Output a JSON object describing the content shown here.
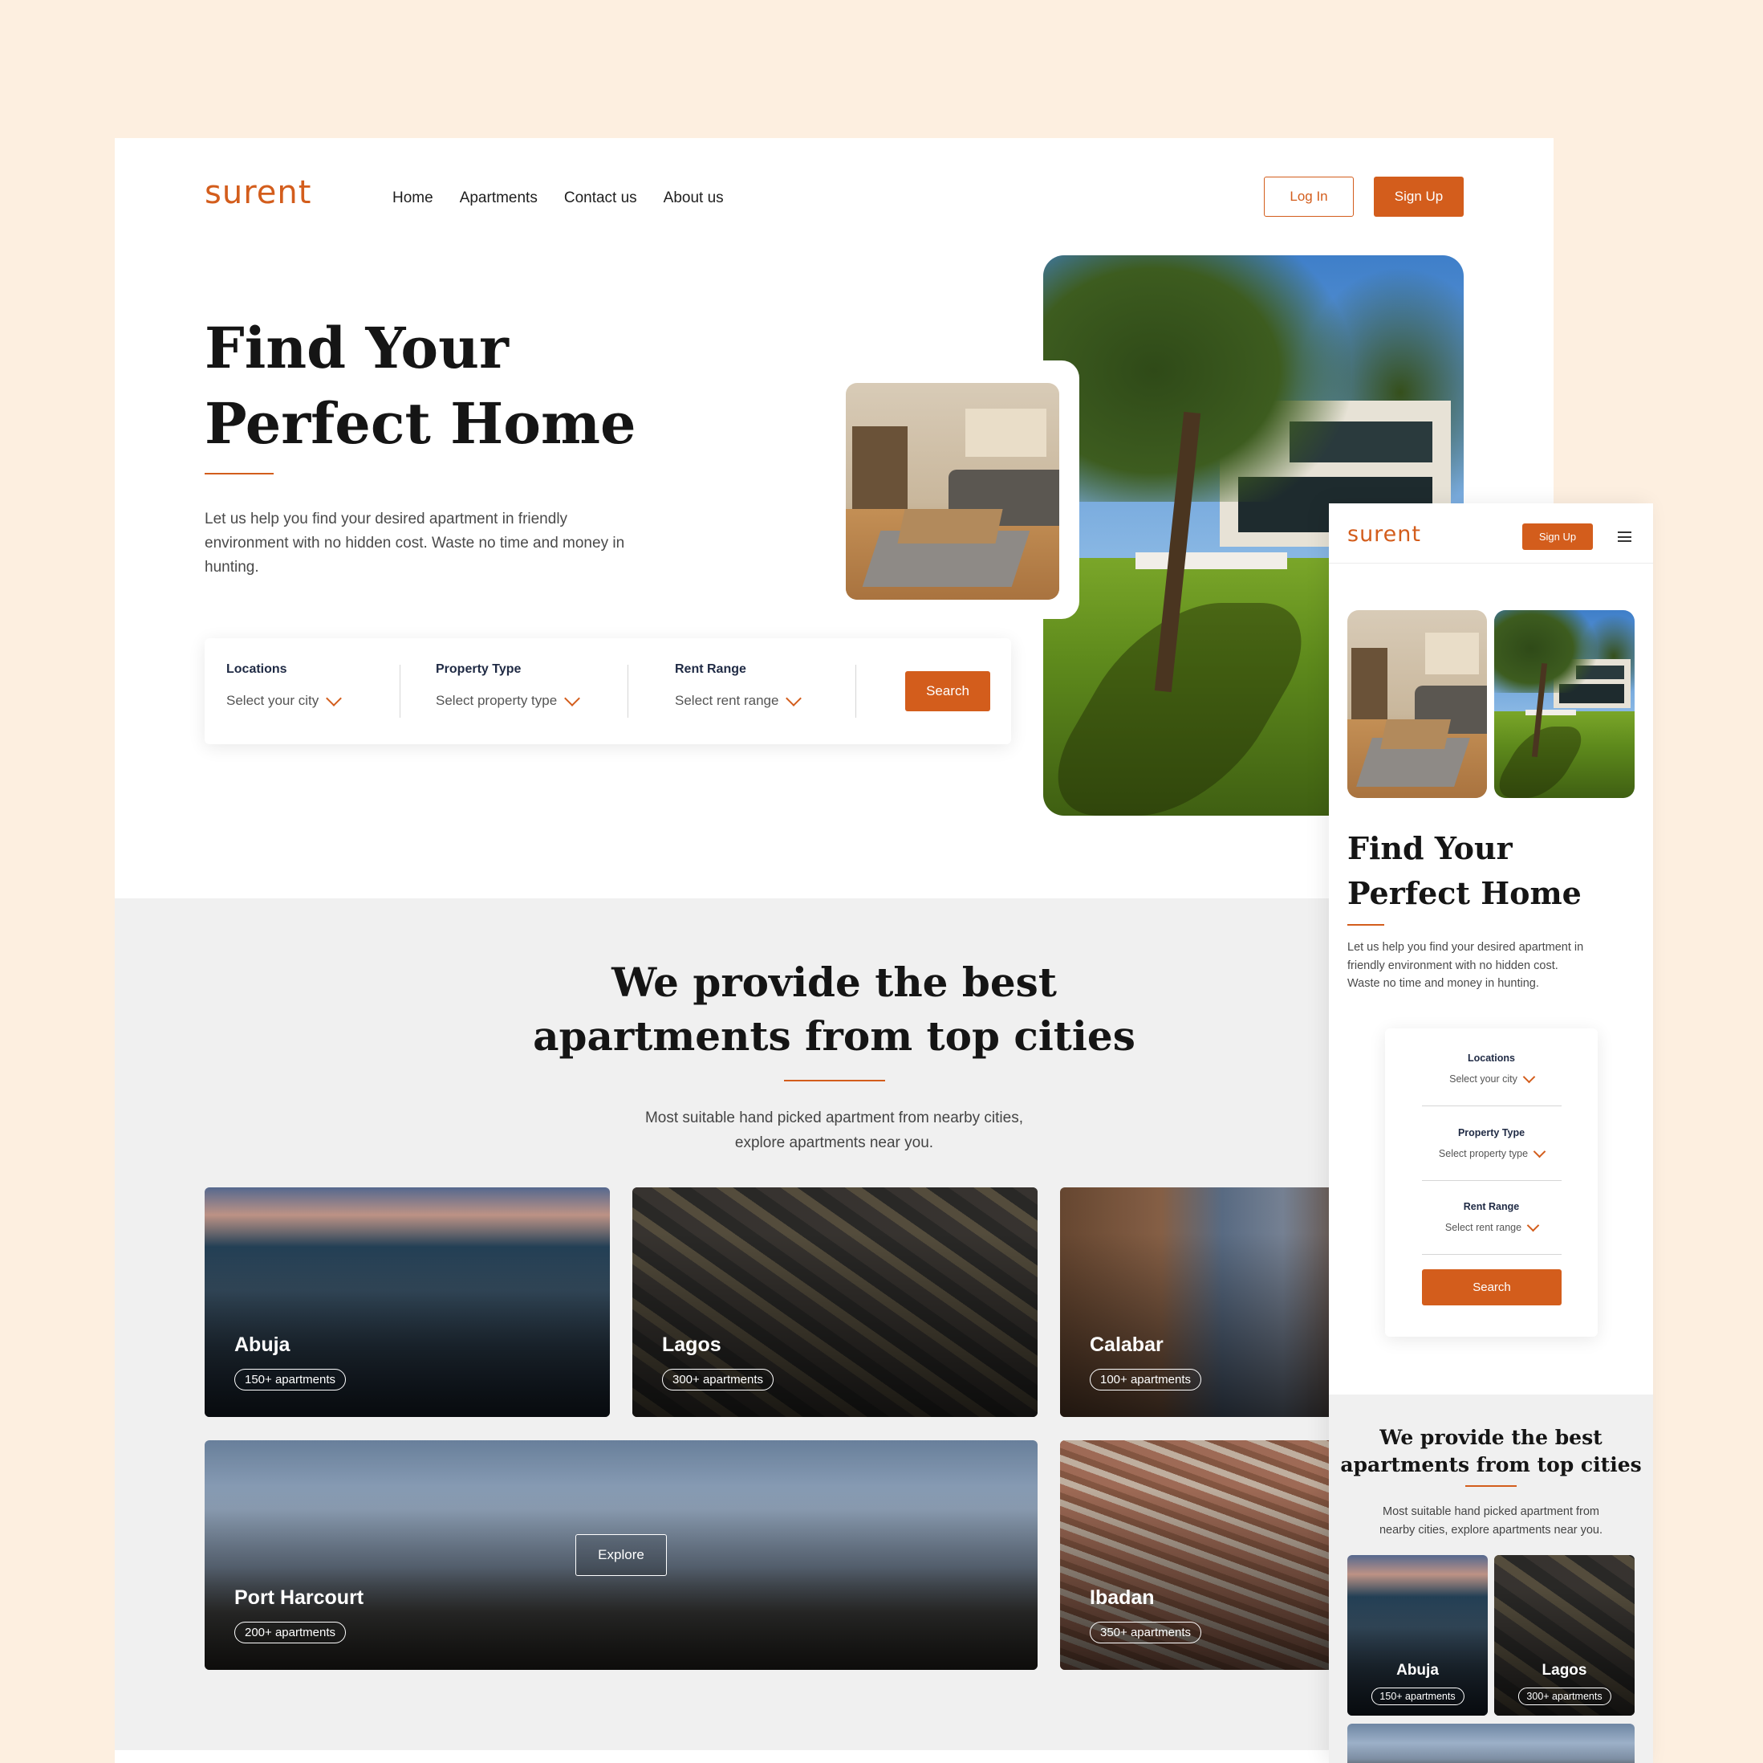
{
  "brand": {
    "logo": "surent",
    "accent": "#d35d1c",
    "page_background": "#fdefe0",
    "section_gray": "#f0f0f0"
  },
  "desktop": {
    "nav": [
      "Home",
      "Apartments",
      "Contact us",
      "About us"
    ],
    "login_label": "Log In",
    "signup_label": "Sign Up",
    "hero": {
      "title_line1": "Find Your",
      "title_line2": "Perfect Home",
      "description": "Let us help you find your desired apartment in friendly environment with no hidden cost. Waste no time and money in hunting."
    },
    "search": {
      "locations_label": "Locations",
      "locations_value": "Select your city",
      "property_label": "Property Type",
      "property_value": "Select property type",
      "rent_label": "Rent Range",
      "rent_value": "Select rent range",
      "button_label": "Search"
    },
    "cities_section": {
      "title_line1": "We provide the best",
      "title_line2": "apartments from top cities",
      "subtitle_line1": "Most suitable hand picked apartment from nearby cities,",
      "subtitle_line2": "explore apartments near you.",
      "explore_label": "Explore",
      "cities": [
        {
          "name": "Abuja",
          "count": "150+ apartments"
        },
        {
          "name": "Lagos",
          "count": "300+ apartments"
        },
        {
          "name": "Calabar",
          "count": "100+ apartments"
        },
        {
          "name": "Port Harcourt",
          "count": "200+ apartments"
        },
        {
          "name": "Ibadan",
          "count": "350+ apartments"
        }
      ]
    }
  },
  "mobile": {
    "signup_label": "Sign Up",
    "menu_icon": "hamburger-icon",
    "hero": {
      "title_line1": "Find Your",
      "title_line2": "Perfect Home",
      "description": "Let us help you find your desired apartment in friendly environment with no hidden cost. Waste no time and money in hunting."
    },
    "search": {
      "locations_label": "Locations",
      "locations_value": "Select your city",
      "property_label": "Property Type",
      "property_value": "Select property type",
      "rent_label": "Rent Range",
      "rent_value": "Select rent range",
      "button_label": "Search"
    },
    "cities_section": {
      "title_line1": "We provide the best",
      "title_line2": "apartments from top cities",
      "subtitle_line1": "Most suitable hand picked apartment from",
      "subtitle_line2": "nearby cities, explore apartments near you.",
      "cities": [
        {
          "name": "Abuja",
          "count": "150+ apartments"
        },
        {
          "name": "Lagos",
          "count": "300+ apartments"
        }
      ]
    }
  }
}
